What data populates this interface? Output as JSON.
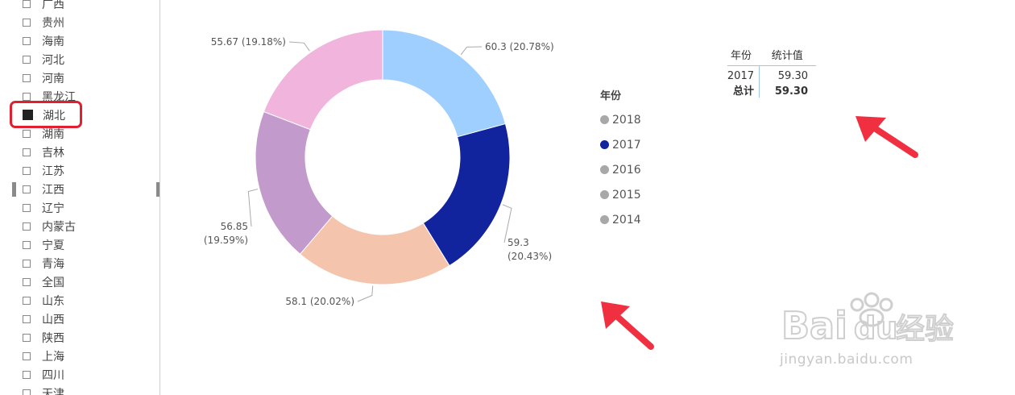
{
  "slicer": {
    "items": [
      {
        "label": "广西",
        "checked": false
      },
      {
        "label": "贵州",
        "checked": false
      },
      {
        "label": "海南",
        "checked": false
      },
      {
        "label": "河北",
        "checked": false
      },
      {
        "label": "河南",
        "checked": false
      },
      {
        "label": "黑龙江",
        "checked": false
      },
      {
        "label": "湖北",
        "checked": true
      },
      {
        "label": "湖南",
        "checked": false
      },
      {
        "label": "吉林",
        "checked": false
      },
      {
        "label": "江苏",
        "checked": false
      },
      {
        "label": "江西",
        "checked": false
      },
      {
        "label": "辽宁",
        "checked": false
      },
      {
        "label": "内蒙古",
        "checked": false
      },
      {
        "label": "宁夏",
        "checked": false
      },
      {
        "label": "青海",
        "checked": false
      },
      {
        "label": "全国",
        "checked": false
      },
      {
        "label": "山东",
        "checked": false
      },
      {
        "label": "山西",
        "checked": false
      },
      {
        "label": "陕西",
        "checked": false
      },
      {
        "label": "上海",
        "checked": false
      },
      {
        "label": "四川",
        "checked": false
      },
      {
        "label": "天津",
        "checked": false
      }
    ]
  },
  "chart_data": {
    "type": "pie",
    "donut": true,
    "slices": [
      {
        "category": "2018",
        "value": 60.3,
        "pct": "20.78%",
        "label": "60.3 (20.78%)",
        "color": "#9fcfff"
      },
      {
        "category": "2017",
        "value": 59.3,
        "pct": "20.43%",
        "label": "59.3 (20.43%)",
        "color": "#12239e"
      },
      {
        "category": "2016",
        "value": 58.1,
        "pct": "20.02%",
        "label": "58.1 (20.02%)",
        "color": "#f4c4ac"
      },
      {
        "category": "2015",
        "value": 56.85,
        "pct": "19.59%",
        "label": "56.85 (19.59%)",
        "color": "#c29acb"
      },
      {
        "category": "2014",
        "value": 55.67,
        "pct": "19.18%",
        "label": "55.67 (19.18%)",
        "color": "#f1b4dc"
      }
    ]
  },
  "legend": {
    "title": "年份",
    "items": [
      {
        "label": "2018",
        "color": "#a8a8a8"
      },
      {
        "label": "2017",
        "color": "#12239e"
      },
      {
        "label": "2016",
        "color": "#a8a8a8"
      },
      {
        "label": "2015",
        "color": "#a8a8a8"
      },
      {
        "label": "2014",
        "color": "#a8a8a8"
      }
    ]
  },
  "table": {
    "headers": {
      "year": "年份",
      "value": "统计值"
    },
    "rows": [
      {
        "year": "2017",
        "value": "59.30"
      }
    ],
    "total": {
      "label": "总计",
      "value": "59.30"
    }
  },
  "watermark": {
    "url": "jingyan.baidu.com"
  },
  "colors": {
    "accent_red": "#e02030",
    "arrow_red": "#f03040"
  }
}
